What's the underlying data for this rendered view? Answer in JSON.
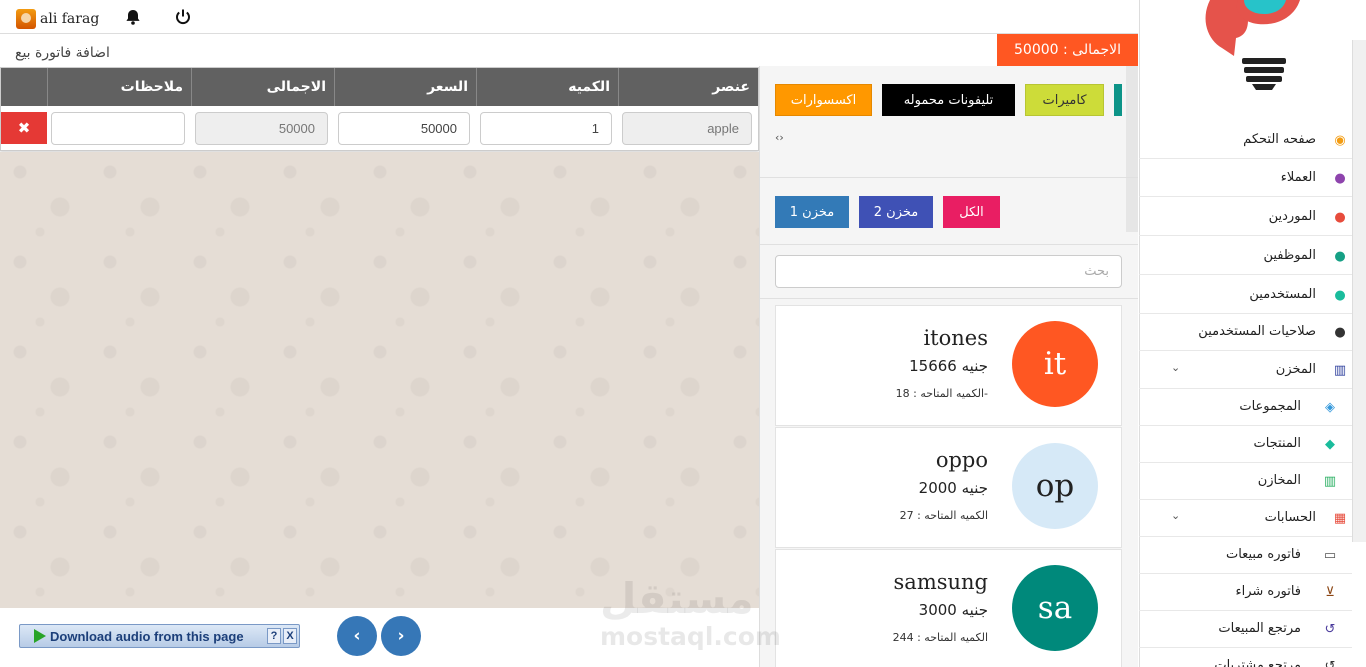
{
  "topbar": {
    "user_name": "ali farag"
  },
  "invoice": {
    "title": "اضافة فاتورة بيع",
    "total_text": "الاجمالى : 50000",
    "columns": [
      "عنصر",
      "الكميه",
      "السعر",
      "الاجمالى",
      "ملاحظات"
    ],
    "rows": [
      {
        "item": "apple",
        "quantity": "1",
        "price": "50000",
        "total": "50000",
        "notes": ""
      }
    ],
    "delete_symbol": "✖"
  },
  "audio_toolbar": {
    "label": "Download audio from this page",
    "help": "?",
    "close": "X"
  },
  "pager": {
    "prev": "‹",
    "next": "›"
  },
  "products_panel": {
    "categories": [
      "كاميرات",
      "تليفونات محموله",
      "اكسسوارات"
    ],
    "scroll_arrows": "‹›",
    "stores": [
      "الكل",
      "مخزن 2",
      "مخزن 1"
    ],
    "search_placeholder": "بحث",
    "products": [
      {
        "name": "itones",
        "price": "15666 جنيه",
        "qty": "الكميه المتاحه : 18-",
        "initials": "it",
        "color": "#ff5722",
        "text_color": "#ffffff"
      },
      {
        "name": "oppo",
        "price": "2000 جنيه",
        "qty": "الكميه المتاحه : 27",
        "initials": "op",
        "color": "#d6e9f7",
        "text_color": "#222222"
      },
      {
        "name": "samsung",
        "price": "3000 جنيه",
        "qty": "الكميه المتاحه : 244",
        "initials": "sa",
        "color": "#00897b",
        "text_color": "#ffffff"
      }
    ]
  },
  "watermark": {
    "arabic": "مستقل",
    "latin": "mostaql.com"
  },
  "sidebar": {
    "items": [
      {
        "label": "صفحه التحكم",
        "icon": "dashboard-icon",
        "glyph": "◉",
        "color": "#f39c12"
      },
      {
        "label": "العملاء",
        "icon": "users-icon",
        "glyph": "●",
        "color": "#8e44ad"
      },
      {
        "label": "الموردين",
        "icon": "users-icon",
        "glyph": "●",
        "color": "#e74c3c"
      },
      {
        "label": "الموظفين",
        "icon": "users-icon",
        "glyph": "●",
        "color": "#16a085"
      },
      {
        "label": "المستخدمين",
        "icon": "users-icon",
        "glyph": "●",
        "color": "#1abc9c"
      },
      {
        "label": "صلاحيات المستخدمين",
        "icon": "users-icon",
        "glyph": "●",
        "color": "#333333"
      },
      {
        "label": "المخزن",
        "icon": "bank-icon",
        "glyph": "▥",
        "color": "#2c3e9c",
        "expandable": true
      },
      {
        "label": "المجموعات",
        "icon": "cubes-icon",
        "glyph": "◈",
        "color": "#3498db",
        "sub": true
      },
      {
        "label": "المنتجات",
        "icon": "cube-icon",
        "glyph": "◆",
        "color": "#1abc9c",
        "sub": true
      },
      {
        "label": "المخازن",
        "icon": "bank-icon",
        "glyph": "▥",
        "color": "#27ae60",
        "sub": true
      },
      {
        "label": "الحسابات",
        "icon": "calculator-icon",
        "glyph": "▦",
        "color": "#e74c3c",
        "expandable": true
      },
      {
        "label": "فاتوره مبيعات",
        "icon": "money-icon",
        "glyph": "▭",
        "color": "#555555",
        "sub": true
      },
      {
        "label": "فاتوره شراء",
        "icon": "cart-icon",
        "glyph": "⊻",
        "color": "#8b4513",
        "sub": true
      },
      {
        "label": "مرتجع المبيعات",
        "icon": "undo-icon",
        "glyph": "↺",
        "color": "#4b3b9c",
        "sub": true
      },
      {
        "label": "مرتجع مشتريات",
        "icon": "undo-icon",
        "glyph": "↺",
        "color": "#333333",
        "sub": true
      }
    ],
    "expand_glyph": "⌄"
  }
}
